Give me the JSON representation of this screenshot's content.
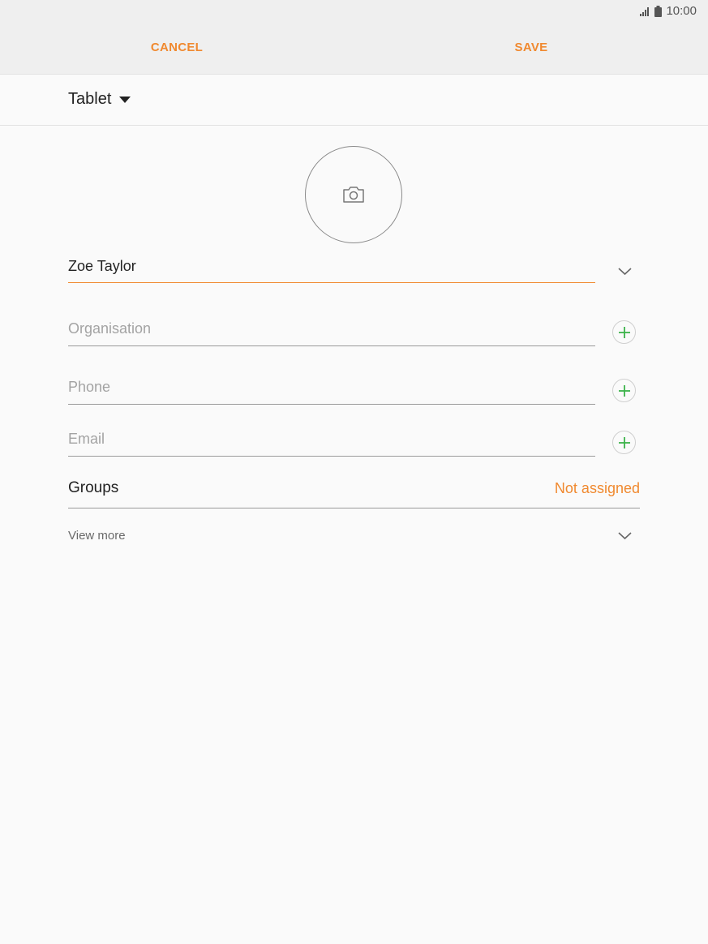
{
  "status_bar": {
    "time": "10:00",
    "icons": [
      "signal-icon",
      "battery-icon"
    ]
  },
  "toolbar": {
    "cancel_label": "CANCEL",
    "save_label": "SAVE"
  },
  "account": {
    "label": "Tablet"
  },
  "photo": {
    "icon": "camera-icon"
  },
  "fields": {
    "name": {
      "value": "Zoe Taylor"
    },
    "organisation": {
      "placeholder": "Organisation"
    },
    "phone": {
      "placeholder": "Phone"
    },
    "email": {
      "placeholder": "Email"
    }
  },
  "groups": {
    "label": "Groups",
    "value": "Not assigned"
  },
  "view_more": {
    "label": "View more"
  },
  "colors": {
    "accent": "#f0892f",
    "plus_icon": "#3cb34a",
    "background": "#fafafa",
    "appbar": "#efefef"
  }
}
